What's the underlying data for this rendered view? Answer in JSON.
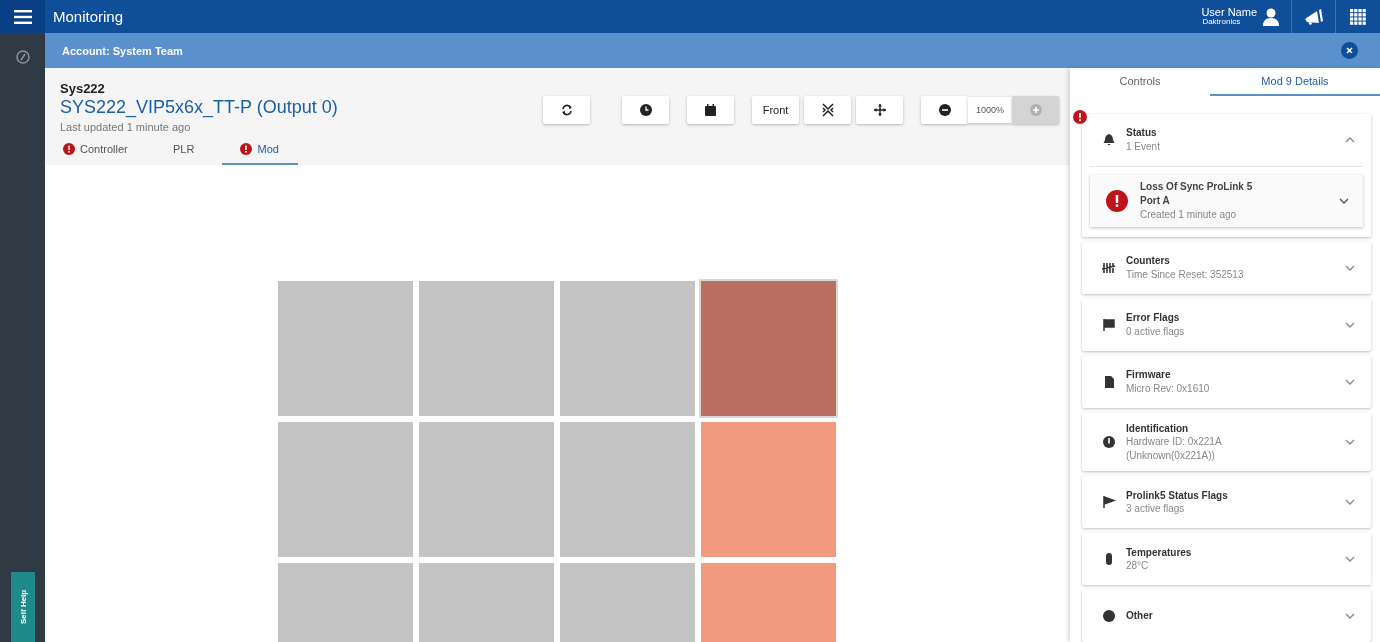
{
  "app_bar": {
    "title": "Monitoring",
    "user_name": "User Name",
    "organization": "Daktronics"
  },
  "account_bar": {
    "label": "Account: System Team"
  },
  "side_help": {
    "label": "Self Help"
  },
  "header": {
    "system": "Sys222",
    "display": "SYS222_VIP5x6x_TT-P (Output 0)",
    "updated": "Last updated 1 minute ago"
  },
  "tabs": [
    {
      "label": "Controller",
      "alert": true,
      "selected": false
    },
    {
      "label": "PLR",
      "alert": false,
      "selected": false
    },
    {
      "label": "Mod",
      "alert": true,
      "selected": true
    }
  ],
  "toolbar": {
    "view_label": "Front",
    "zoom": "1000%",
    "zoom_in_disabled": true
  },
  "tiles": [
    {
      "color": "#c4c4c4",
      "selected": false
    },
    {
      "color": "#c4c4c4",
      "selected": false
    },
    {
      "color": "#c4c4c4",
      "selected": false
    },
    {
      "color": "#b97060",
      "selected": true
    },
    {
      "color": "#c4c4c4",
      "selected": false
    },
    {
      "color": "#c4c4c4",
      "selected": false
    },
    {
      "color": "#c4c4c4",
      "selected": false
    },
    {
      "color": "#f29a80",
      "selected": false
    },
    {
      "color": "#c4c4c4",
      "selected": false
    },
    {
      "color": "#c4c4c4",
      "selected": false
    },
    {
      "color": "#c4c4c4",
      "selected": false
    },
    {
      "color": "#f29a80",
      "selected": false
    }
  ],
  "panel_tabs": [
    {
      "label": "Controls",
      "selected": false
    },
    {
      "label": "Mod 9 Details",
      "selected": true
    }
  ],
  "cards": [
    {
      "title": "Status",
      "subtitle": "1 Event",
      "alert": true,
      "expanded": true,
      "events": [
        {
          "title": "Loss Of Sync ProLink 5 Port A",
          "time": "Created 1 minute ago"
        }
      ]
    },
    {
      "title": "Counters",
      "subtitle": "Time Since Reset: 352513",
      "alert": false,
      "expanded": false
    },
    {
      "title": "Error Flags",
      "subtitle": "0 active flags",
      "alert": false,
      "expanded": false
    },
    {
      "title": "Firmware",
      "subtitle": "Micro Rev: 0x1610",
      "alert": false,
      "expanded": false
    },
    {
      "title": "Identification",
      "subtitle": "Hardware ID: 0x221A (Unknown(0x221A))",
      "alert": false,
      "expanded": false
    },
    {
      "title": "Prolink5 Status Flags",
      "subtitle": "3 active flags",
      "alert": false,
      "expanded": false
    },
    {
      "title": "Temperatures",
      "subtitle": "28°C",
      "alert": false,
      "expanded": false
    },
    {
      "title": "Other",
      "alert": false,
      "expanded": false
    }
  ]
}
